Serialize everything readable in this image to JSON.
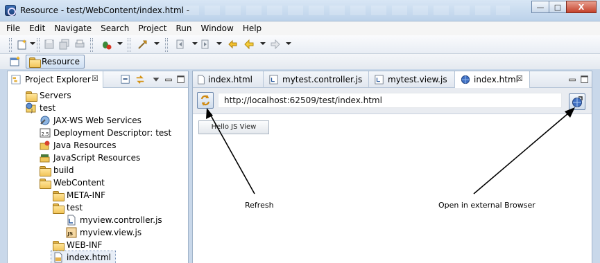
{
  "window": {
    "title": "Resource - test/WebContent/index.html -",
    "minimize_label": "—",
    "maximize_label": "□",
    "close_label": "X"
  },
  "menu": [
    "File",
    "Edit",
    "Navigate",
    "Search",
    "Project",
    "Run",
    "Window",
    "Help"
  ],
  "toolbar": {
    "icons": [
      "new-wizard-icon",
      "save-icon",
      "save-all-icon",
      "print-icon",
      "debug-icon",
      "run-tool-icon",
      "next-annotation-icon",
      "previous-annotation-icon",
      "last-edit-icon",
      "back-icon",
      "forward-icon"
    ]
  },
  "perspective": {
    "active": "Resource"
  },
  "explorer": {
    "tab_label": "Project Explorer",
    "tab_close": "☒",
    "items": [
      {
        "label": "Servers",
        "icon": "folder-icon",
        "depth": 1
      },
      {
        "label": "test",
        "icon": "web-project-icon",
        "depth": 1
      },
      {
        "label": "JAX-WS Web Services",
        "icon": "web-services-icon",
        "depth": 2
      },
      {
        "label": "Deployment Descriptor: test",
        "icon": "deployment-descriptor-icon",
        "depth": 2
      },
      {
        "label": "Java Resources",
        "icon": "java-resources-icon",
        "depth": 2
      },
      {
        "label": "JavaScript Resources",
        "icon": "javascript-resources-icon",
        "depth": 2
      },
      {
        "label": "build",
        "icon": "folder-icon",
        "depth": 2
      },
      {
        "label": "WebContent",
        "icon": "folder-icon",
        "depth": 2
      },
      {
        "label": "META-INF",
        "icon": "folder-icon",
        "depth": 3
      },
      {
        "label": "test",
        "icon": "folder-icon",
        "depth": 3
      },
      {
        "label": "myview.controller.js",
        "icon": "js-file-icon",
        "depth": 4
      },
      {
        "label": "myview.view.js",
        "icon": "js-view-file-icon",
        "depth": 4
      },
      {
        "label": "WEB-INF",
        "icon": "folder-icon",
        "depth": 3
      },
      {
        "label": "index.html",
        "icon": "html-file-icon",
        "depth": 3
      }
    ]
  },
  "editor": {
    "tabs": [
      {
        "label": "index.html",
        "icon": "html-file-icon",
        "active": false
      },
      {
        "label": "mytest.controller.js",
        "icon": "js-file-icon",
        "active": false
      },
      {
        "label": "mytest.view.js",
        "icon": "js-file-icon",
        "active": false
      },
      {
        "label": "index.html",
        "icon": "browser-globe-icon",
        "active": true
      }
    ],
    "tab_close": "☒",
    "url": "http://localhost:62509/test/index.html",
    "page_button": "Hello JS View"
  },
  "annotations": {
    "refresh": "Refresh",
    "external": "Open in external Browser"
  }
}
